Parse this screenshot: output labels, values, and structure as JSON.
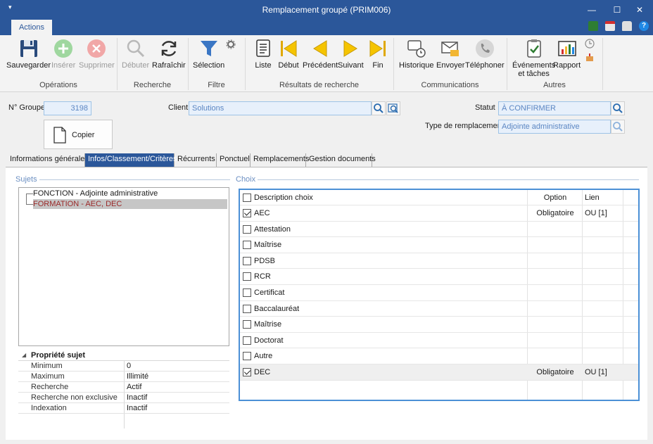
{
  "window": {
    "title": "Remplacement groupé (PRIM006)"
  },
  "ribbon": {
    "tab": "Actions",
    "buttons": {
      "save": "Sauvegarder",
      "insert": "Insérer",
      "delete": "Supprimer",
      "start": "Débuter",
      "refresh": "Rafraîchir",
      "selection": "Sélection",
      "list": "Liste",
      "first": "Début",
      "previous": "Précédent",
      "next": "Suivant",
      "last": "Fin",
      "history": "Historique",
      "send": "Envoyer",
      "phone": "Téléphoner",
      "events_line1": "Événements",
      "events_line2": "et tâches",
      "report": "Rapport"
    },
    "groups": {
      "operations": "Opérations",
      "search": "Recherche",
      "filter": "Filtre",
      "results": "Résultats de recherche",
      "communications": "Communications",
      "others": "Autres"
    }
  },
  "form": {
    "group_no_label": "N° Groupe",
    "group_no": "3198",
    "client_label": "Client",
    "client": "Solutions",
    "status_label": "Statut",
    "status": "À CONFIRMER",
    "type_label": "Type de remplacement",
    "type": "Adjointe administrative",
    "copy_button": "Copier"
  },
  "tabs": [
    "Informations générales",
    "Infos/Classement/Critères",
    "Récurrents",
    "Ponctuel",
    "Remplacements",
    "Gestion documents"
  ],
  "subjects": {
    "title": "Sujets",
    "items": [
      "FONCTION - Adjointe administrative",
      "FORMATION - AEC, DEC"
    ]
  },
  "properties": {
    "header": "Propriété sujet",
    "rows": [
      {
        "key": "Minimum",
        "value": "0"
      },
      {
        "key": "Maximum",
        "value": "Illimité"
      },
      {
        "key": "Recherche",
        "value": "Actif"
      },
      {
        "key": "Recherche non exclusive",
        "value": "Inactif"
      },
      {
        "key": "Indexation",
        "value": "Inactif"
      }
    ]
  },
  "choices": {
    "title": "Choix",
    "columns": {
      "desc": "Description choix",
      "option": "Option",
      "lien": "Lien"
    },
    "rows": [
      {
        "desc": "AEC",
        "checked": true,
        "option": "Obligatoire",
        "lien": "OU [1]"
      },
      {
        "desc": "Attestation",
        "checked": false,
        "option": "",
        "lien": ""
      },
      {
        "desc": "Maîtrise",
        "checked": false,
        "option": "",
        "lien": ""
      },
      {
        "desc": "PDSB",
        "checked": false,
        "option": "",
        "lien": ""
      },
      {
        "desc": "RCR",
        "checked": false,
        "option": "",
        "lien": ""
      },
      {
        "desc": "Certificat",
        "checked": false,
        "option": "",
        "lien": ""
      },
      {
        "desc": "Baccalauréat",
        "checked": false,
        "option": "",
        "lien": ""
      },
      {
        "desc": "Maîtrise",
        "checked": false,
        "option": "",
        "lien": ""
      },
      {
        "desc": "Doctorat",
        "checked": false,
        "option": "",
        "lien": ""
      },
      {
        "desc": "Autre",
        "checked": false,
        "option": "",
        "lien": ""
      },
      {
        "desc": "DEC",
        "checked": true,
        "option": "Obligatoire",
        "lien": "OU [1]"
      }
    ]
  },
  "colors": {
    "accent": "#2b579a",
    "field_bg": "#e7f0fb",
    "field_text": "#5b86c3",
    "grid_border": "#4b90d6"
  }
}
